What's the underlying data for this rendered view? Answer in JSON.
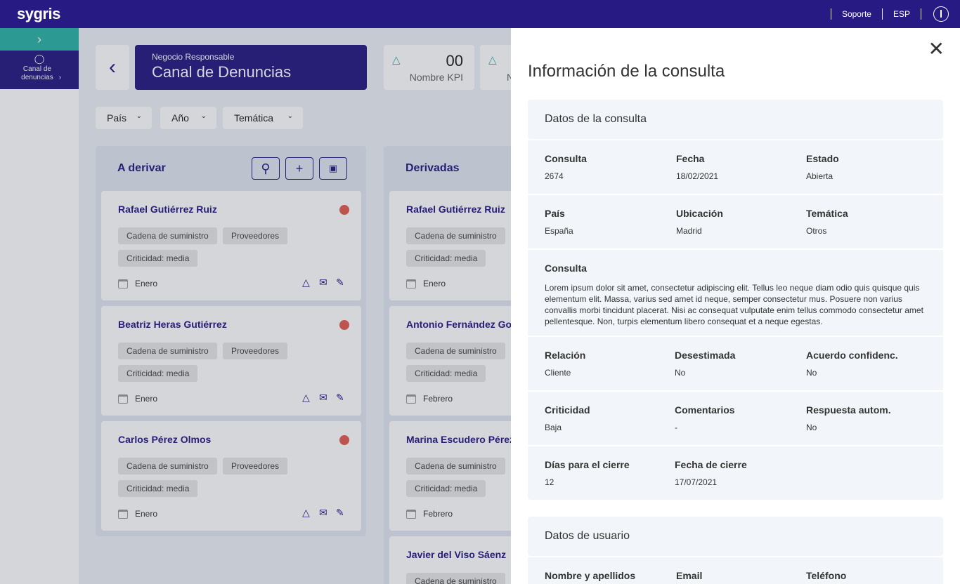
{
  "header": {
    "logo": "sygris",
    "support": "Soporte",
    "language": "ESP"
  },
  "sidebar": {
    "toggle_icon": "›",
    "item_label": "Canal de denuncias"
  },
  "page": {
    "subtitle": "Negocio Responsable",
    "title": "Canal de Denuncias"
  },
  "kpis": [
    {
      "value": "00",
      "label": "Nombre KPI"
    },
    {
      "value": "",
      "label": "N"
    }
  ],
  "filters": [
    "País",
    "Año",
    "Temática"
  ],
  "columns": [
    {
      "title": "A derivar",
      "cards": [
        {
          "name": "Rafael Gutiérrez Ruiz",
          "tags": [
            "Cadena de suministro",
            "Proveedores",
            "Criticidad: media"
          ],
          "month": "Enero"
        },
        {
          "name": "Beatriz Heras Gutiérrez",
          "tags": [
            "Cadena de suministro",
            "Proveedores",
            "Criticidad: media"
          ],
          "month": "Enero"
        },
        {
          "name": "Carlos Pérez Olmos",
          "tags": [
            "Cadena de suministro",
            "Proveedores",
            "Criticidad: media"
          ],
          "month": "Enero"
        }
      ]
    },
    {
      "title": "Derivadas",
      "cards": [
        {
          "name": "Rafael Gutiérrez Ruiz",
          "tags": [
            "Cadena de suministro",
            "",
            "Criticidad: media"
          ],
          "month": "Enero"
        },
        {
          "name": "Antonio Fernández Goya",
          "tags": [
            "Cadena de suministro",
            "",
            "Criticidad: media"
          ],
          "month": "Febrero"
        },
        {
          "name": "Marina Escudero Pérez",
          "tags": [
            "Cadena de suministro",
            "",
            "Criticidad: media"
          ],
          "month": "Febrero"
        },
        {
          "name": "Javier del Viso Sáenz",
          "tags": [
            "Cadena de suministro",
            "",
            ""
          ],
          "month": ""
        }
      ]
    }
  ],
  "panel": {
    "title": "Información de la consulta",
    "section1": "Datos de la consulta",
    "rows": [
      [
        {
          "label": "Consulta",
          "value": "2674"
        },
        {
          "label": "Fecha",
          "value": "18/02/2021"
        },
        {
          "label": "Estado",
          "value": "Abierta"
        }
      ],
      [
        {
          "label": "País",
          "value": "España"
        },
        {
          "label": "Ubicación",
          "value": "Madrid"
        },
        {
          "label": "Temática",
          "value": "Otros"
        }
      ],
      [
        {
          "label": "Relación",
          "value": "Cliente"
        },
        {
          "label": "Desestimada",
          "value": "No"
        },
        {
          "label": "Acuerdo confidenc.",
          "value": "No"
        }
      ],
      [
        {
          "label": "Criticidad",
          "value": "Baja"
        },
        {
          "label": "Comentarios",
          "value": "-"
        },
        {
          "label": "Respuesta autom.",
          "value": "No"
        }
      ],
      [
        {
          "label": "Días para el cierre",
          "value": "12"
        },
        {
          "label": "Fecha de cierre",
          "value": "17/07/2021"
        }
      ]
    ],
    "consulta_label": "Consulta",
    "consulta_text": "Lorem ipsum dolor sit amet, consectetur adipiscing elit. Tellus leo neque diam odio quis quisque quis elementum elit. Massa, varius sed amet id neque, semper consectetur mus. Posuere non varius convallis morbi tincidunt placerat. Nisi ac consequat vulputate enim tellus commodo consectetur amet pellentesque. Non, turpis elementum libero consequat et a neque egestas.",
    "section2": "Datos de usuario",
    "user_fields": [
      "Nombre y apellidos",
      "Email",
      "Teléfono"
    ]
  },
  "colors": {
    "primary": "#271a83",
    "accent": "#2eb3a5",
    "alert": "#e35d4f"
  }
}
